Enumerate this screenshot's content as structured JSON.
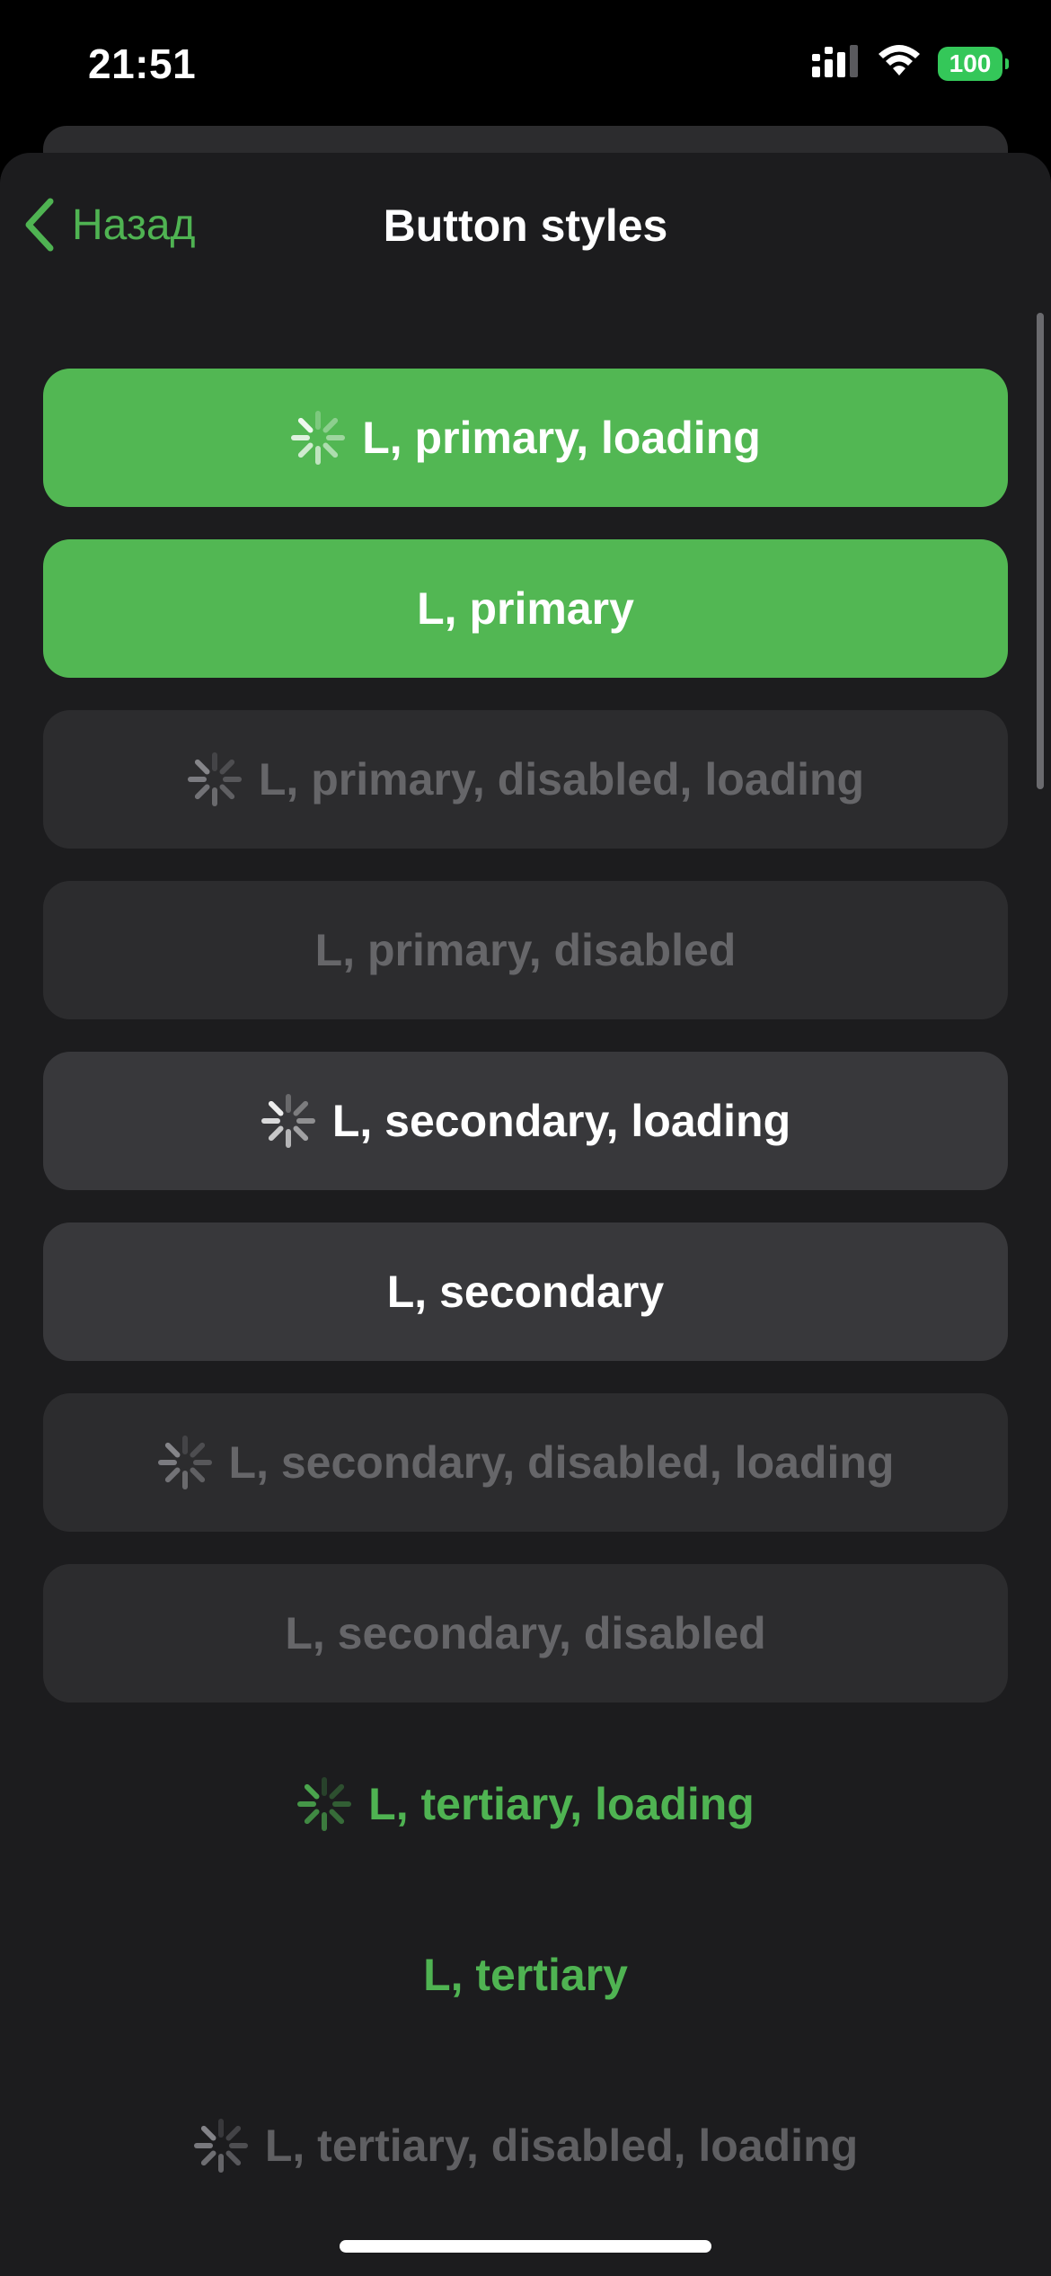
{
  "status_bar": {
    "time": "21:51",
    "battery_level": "100",
    "icons": [
      "signal-icon",
      "wifi-icon",
      "battery-icon"
    ]
  },
  "nav": {
    "back_label": "Назад",
    "title": "Button styles"
  },
  "colors": {
    "accent": "#4fb352",
    "primary_fill": "#52b753",
    "secondary_fill": "#38383b",
    "disabled_fill": "#2c2c2e",
    "disabled_text": "#666669",
    "sheet_bg": "#1c1c1e"
  },
  "buttons": [
    {
      "label": "L, primary, loading"
    },
    {
      "label": "L, primary"
    },
    {
      "label": "L, primary, disabled, loading"
    },
    {
      "label": "L, primary, disabled"
    },
    {
      "label": "L, secondary, loading"
    },
    {
      "label": "L, secondary"
    },
    {
      "label": "L, secondary, disabled, loading"
    },
    {
      "label": "L, secondary, disabled"
    },
    {
      "label": "L, tertiary, loading"
    },
    {
      "label": "L, tertiary"
    },
    {
      "label": "L, tertiary, disabled, loading"
    }
  ]
}
